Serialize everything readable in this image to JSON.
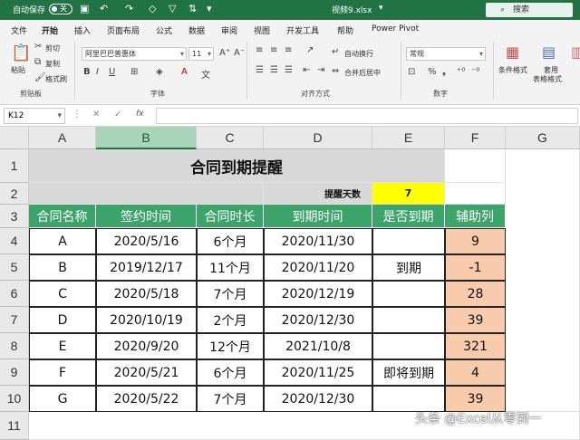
{
  "titlebar": {
    "autosave_label": "自动保存",
    "autosave_state": "关",
    "filename": "视频9.xlsx",
    "search_placeholder": "搜索"
  },
  "menu": [
    "文件",
    "开始",
    "插入",
    "页面布局",
    "公式",
    "数据",
    "审阅",
    "视图",
    "开发工具",
    "帮助",
    "Power Pivot"
  ],
  "ribbon": {
    "paste": "粘贴",
    "cut": "剪切",
    "copy": "复制",
    "format_painter": "格式刷",
    "clipboard_group": "剪贴板",
    "font_name": "阿里巴巴普惠体",
    "font_size": "11",
    "font_group": "字体",
    "wrap_text": "自动换行",
    "merge_center": "合并后居中",
    "alignment_group": "对齐方式",
    "number_format": "常规",
    "number_group": "数字",
    "conditional_format": "条件格式",
    "table_format_1": "套用",
    "table_format_2": "表格格式"
  },
  "formula_bar": {
    "name_box": "K12",
    "formula": ""
  },
  "columns": [
    "A",
    "B",
    "C",
    "D",
    "E",
    "F",
    "G"
  ],
  "rows": [
    "1",
    "2",
    "3",
    "4",
    "5",
    "6",
    "7",
    "8",
    "9",
    "10",
    "11"
  ],
  "sheet": {
    "title": "合同到期提醒",
    "remind_label": "提醒天数",
    "remind_days": "7",
    "headers": [
      "合同名称",
      "签约时间",
      "合同时长",
      "到期时间",
      "是否到期",
      "辅助列"
    ],
    "records": [
      [
        "A",
        "2020/5/16",
        "6个月",
        "2020/11/30",
        "",
        "9"
      ],
      [
        "B",
        "2019/12/17",
        "11个月",
        "2020/11/20",
        "到期",
        "-1"
      ],
      [
        "C",
        "2020/5/18",
        "7个月",
        "2020/12/19",
        "",
        "28"
      ],
      [
        "D",
        "2020/10/19",
        "2个月",
        "2020/12/30",
        "",
        "39"
      ],
      [
        "E",
        "2020/9/20",
        "12个月",
        "2021/10/8",
        "",
        "321"
      ],
      [
        "F",
        "2020/5/21",
        "6个月",
        "2020/11/25",
        "即将到期",
        "4"
      ],
      [
        "G",
        "2020/5/22",
        "7个月",
        "2020/12/30",
        "",
        "39"
      ]
    ]
  },
  "watermark": "头条 @Excel从零到一",
  "colors": {
    "accent": "#217346",
    "header_fill": "#3ca36b",
    "title_fill": "#d9d9d9",
    "remind_fill": "#ffff00",
    "helper_fill": "#f8cbad"
  }
}
